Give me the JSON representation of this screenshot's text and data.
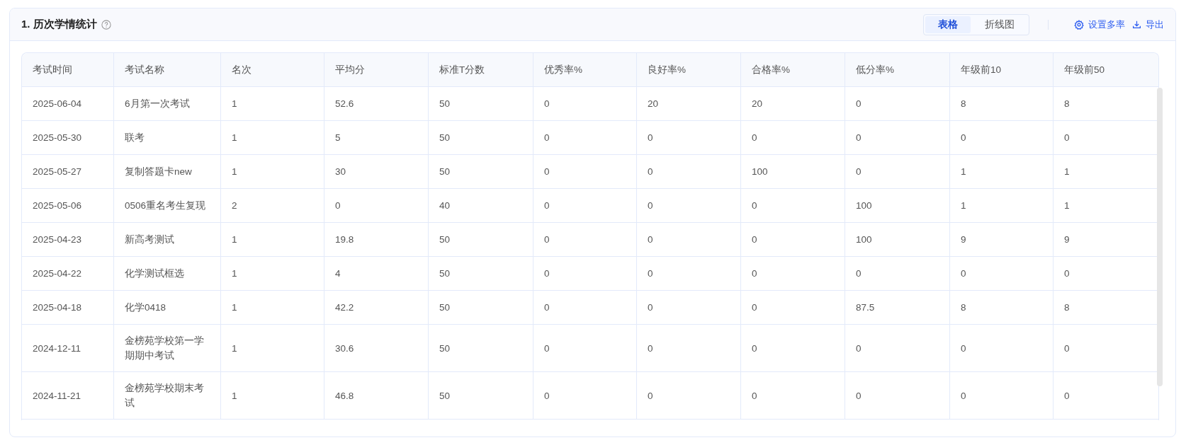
{
  "panel": {
    "title": "1. 历次学情统计"
  },
  "view_tabs": [
    {
      "label": "表格",
      "selected": true
    },
    {
      "label": "折线图",
      "selected": false
    }
  ],
  "actions": [
    {
      "kind": "settings",
      "label": "设置多率"
    },
    {
      "kind": "export",
      "label": "导出"
    }
  ],
  "table": {
    "columns": [
      "考试时间",
      "考试名称",
      "名次",
      "平均分",
      "标准T分数",
      "优秀率%",
      "良好率%",
      "合格率%",
      "低分率%",
      "年级前10",
      "年级前50"
    ],
    "rows": [
      [
        "2025-06-04",
        "6月第一次考试",
        "1",
        "52.6",
        "50",
        "0",
        "20",
        "20",
        "0",
        "8",
        "8"
      ],
      [
        "2025-05-30",
        "联考",
        "1",
        "5",
        "50",
        "0",
        "0",
        "0",
        "0",
        "0",
        "0"
      ],
      [
        "2025-05-27",
        "复制答题卡new",
        "1",
        "30",
        "50",
        "0",
        "0",
        "100",
        "0",
        "1",
        "1"
      ],
      [
        "2025-05-06",
        "0506重名考生复现",
        "2",
        "0",
        "40",
        "0",
        "0",
        "0",
        "100",
        "1",
        "1"
      ],
      [
        "2025-04-23",
        "新高考测试",
        "1",
        "19.8",
        "50",
        "0",
        "0",
        "0",
        "100",
        "9",
        "9"
      ],
      [
        "2025-04-22",
        "化学测试框选",
        "1",
        "4",
        "50",
        "0",
        "0",
        "0",
        "0",
        "0",
        "0"
      ],
      [
        "2025-04-18",
        "化学0418",
        "1",
        "42.2",
        "50",
        "0",
        "0",
        "0",
        "87.5",
        "8",
        "8"
      ],
      [
        "2024-12-11",
        "金榜苑学校第一学期期中考试",
        "1",
        "30.6",
        "50",
        "0",
        "0",
        "0",
        "0",
        "0",
        "0"
      ],
      [
        "2024-11-21",
        "金榜苑学校期末考试",
        "1",
        "46.8",
        "50",
        "0",
        "0",
        "0",
        "0",
        "0",
        "0"
      ]
    ]
  }
}
